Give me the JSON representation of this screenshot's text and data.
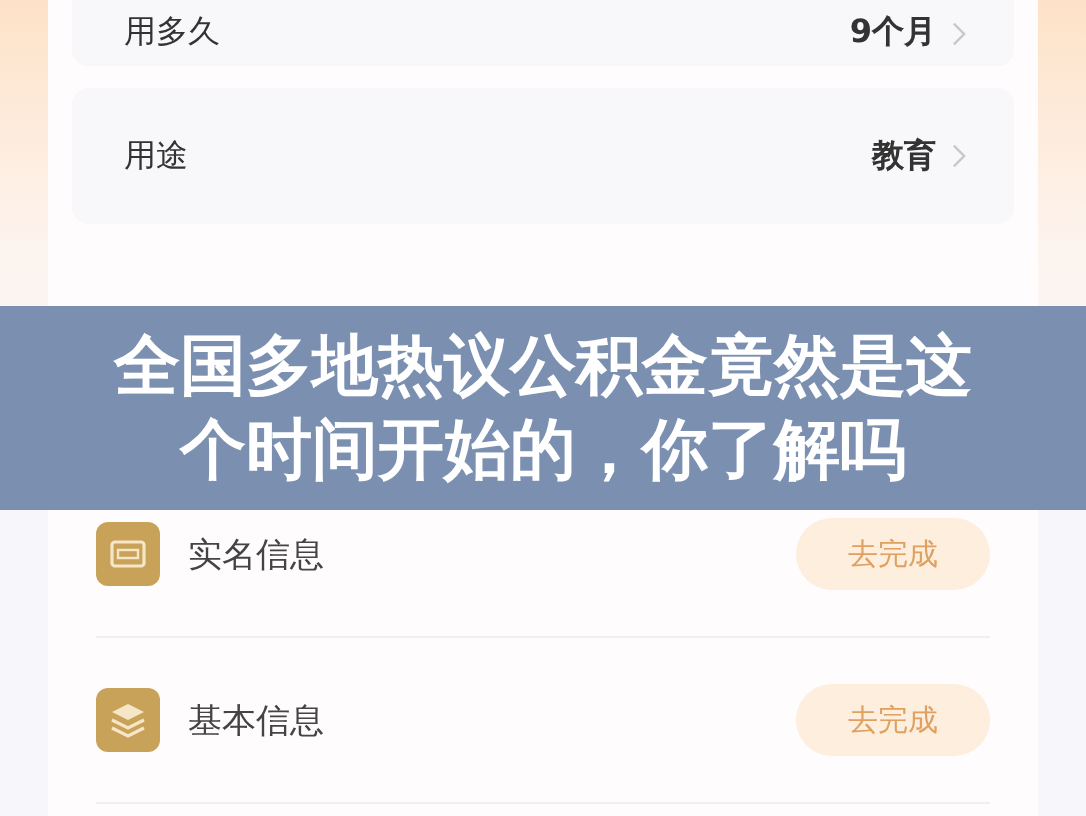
{
  "options": [
    {
      "label": "用多久",
      "value": "9个月"
    },
    {
      "label": "用途",
      "value": "教育"
    }
  ],
  "banner": {
    "title": "全国多地热议公积金竟然是这个时间开始的，你了解吗"
  },
  "tasks": [
    {
      "kind": "id-card",
      "label": "实名信息",
      "action": "去完成"
    },
    {
      "kind": "layers",
      "label": "基本信息",
      "action": "去完成"
    }
  ]
}
